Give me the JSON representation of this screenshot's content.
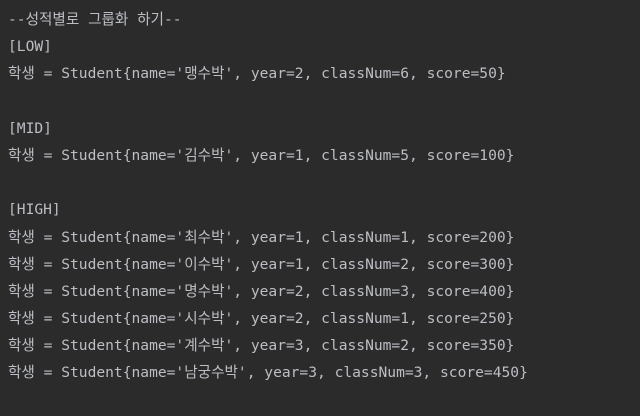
{
  "console": {
    "header": "--성적별로 그룹화 하기--",
    "groups": [
      {
        "label": "[LOW]",
        "rows": [
          "학생 = Student{name='맹수박', year=2, classNum=6, score=50}"
        ]
      },
      {
        "label": "[MID]",
        "rows": [
          "학생 = Student{name='김수박', year=1, classNum=5, score=100}"
        ]
      },
      {
        "label": "[HIGH]",
        "rows": [
          "학생 = Student{name='최수박', year=1, classNum=1, score=200}",
          "학생 = Student{name='이수박', year=1, classNum=2, score=300}",
          "학생 = Student{name='명수박', year=2, classNum=3, score=400}",
          "학생 = Student{name='시수박', year=2, classNum=1, score=250}",
          "학생 = Student{name='계수박', year=3, classNum=2, score=350}",
          "학생 = Student{name='남궁수박', year=3, classNum=3, score=450}"
        ]
      }
    ]
  },
  "colors": {
    "background": "#2b2b2b",
    "text": "#bcbec4"
  }
}
